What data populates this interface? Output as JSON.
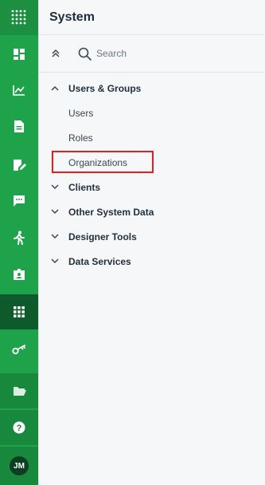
{
  "panel": {
    "title": "System",
    "search": {
      "placeholder": "Search"
    }
  },
  "tree": {
    "groups": [
      {
        "label": "Users & Groups",
        "expanded": true,
        "children": [
          {
            "label": "Users"
          },
          {
            "label": "Roles"
          },
          {
            "label": "Organizations"
          }
        ]
      },
      {
        "label": "Clients",
        "expanded": false
      },
      {
        "label": "Other System Data",
        "expanded": false
      },
      {
        "label": "Designer Tools",
        "expanded": false
      },
      {
        "label": "Data Services",
        "expanded": false
      }
    ]
  },
  "rail": {
    "items": [
      {
        "icon": "app-grid-icon"
      },
      {
        "icon": "dashboard-icon"
      },
      {
        "icon": "chart-line-icon"
      },
      {
        "icon": "document-icon"
      },
      {
        "icon": "edit-document-icon"
      },
      {
        "icon": "chat-icon"
      },
      {
        "icon": "activity-icon"
      },
      {
        "icon": "contact-card-icon"
      },
      {
        "icon": "system-grid-icon",
        "active": true
      },
      {
        "icon": "key-icon"
      },
      {
        "icon": "folder-icon"
      },
      {
        "icon": "help-icon"
      }
    ],
    "avatar_initials": "JM"
  },
  "colors": {
    "rail": "#1fa34a",
    "rail_active": "#0f5a2a",
    "panel_bg": "#f5f7f9",
    "highlight": "#e02020"
  }
}
